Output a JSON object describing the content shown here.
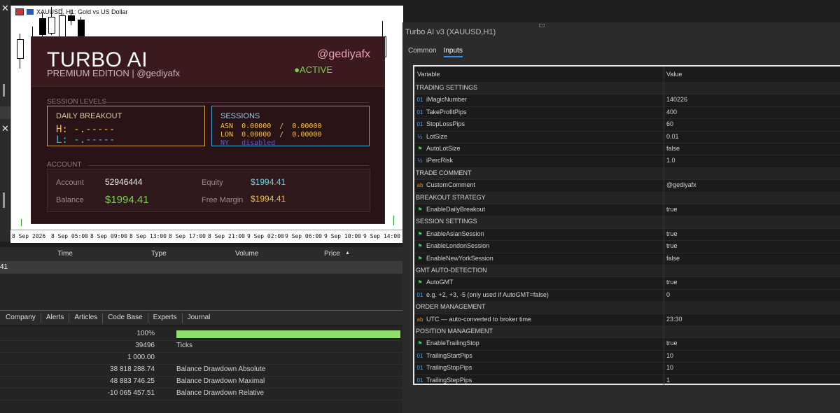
{
  "chart": {
    "symbol_title": "XAUUSD, H1:  Gold vs US Dollar",
    "time_labels": [
      "8 Sep 2026",
      "8 Sep 05:00",
      "8 Sep 09:00",
      "8 Sep 13:00",
      "8 Sep 17:00",
      "8 Sep 21:00",
      "9 Sep 02:00",
      "9 Sep 06:00",
      "9 Sep 10:00",
      "9 Sep 14:00"
    ]
  },
  "turbo_panel": {
    "title": "TURBO AI",
    "subtitle": "PREMIUM EDITION  |  @gediyafx",
    "handle": "@gediyafx",
    "status": "●ACTIVE",
    "session_levels_label": "SESSION LEVELS",
    "daily_breakout": {
      "label": "DAILY BREAKOUT",
      "high": "H: -.-----",
      "low": "L: -.-----"
    },
    "sessions": {
      "label": "SESSIONS",
      "asn": "ASN  0.00000  /  0.00000",
      "lon": "LON  0.00000  /  0.00000",
      "ny": "NY   disabled"
    },
    "account_label": "ACCOUNT",
    "account": {
      "account_label": "Account",
      "account_value": "52946444",
      "equity_label": "Equity",
      "equity_value": "$1994.41",
      "balance_label": "Balance",
      "balance_value": "$1994.41",
      "free_margin_label": "Free Margin",
      "free_margin_value": "$1994.41"
    }
  },
  "dialog": {
    "title": "Turbo AI v3 (XAUUSD,H1)",
    "tabs": [
      "Common",
      "Inputs"
    ],
    "active_tab": "Inputs",
    "columns": [
      "Variable",
      "Value"
    ],
    "rows": [
      {
        "section": true,
        "name": "TRADING SETTINGS",
        "value": ""
      },
      {
        "icon": "01",
        "name": "iMagicNumber",
        "value": "140226"
      },
      {
        "icon": "01",
        "name": "TakeProfitPips",
        "value": "400"
      },
      {
        "icon": "01",
        "name": "StopLossPips",
        "value": "60"
      },
      {
        "icon": "½",
        "name": "LotSize",
        "value": "0.01"
      },
      {
        "icon": "flag",
        "name": "AutoLotSize",
        "value": "false"
      },
      {
        "icon": "½",
        "name": "iPercRisk",
        "value": "1.0"
      },
      {
        "section": true,
        "name": "TRADE COMMENT",
        "value": ""
      },
      {
        "icon": "ab",
        "name": "CustomComment",
        "value": "@gediyafx"
      },
      {
        "section": true,
        "name": "BREAKOUT STRATEGY",
        "value": ""
      },
      {
        "icon": "flag",
        "name": "EnableDailyBreakout",
        "value": "true"
      },
      {
        "section": true,
        "name": "SESSION SETTINGS",
        "value": ""
      },
      {
        "icon": "flag",
        "name": "EnableAsianSession",
        "value": "true"
      },
      {
        "icon": "flag",
        "name": "EnableLondonSession",
        "value": "true"
      },
      {
        "icon": "flag",
        "name": "EnableNewYorkSession",
        "value": "false"
      },
      {
        "section": true,
        "name": "GMT AUTO-DETECTION",
        "value": ""
      },
      {
        "icon": "flag",
        "name": "AutoGMT",
        "value": "true"
      },
      {
        "icon": "01",
        "name": "e.g. +2, +3, -5 (only used if AutoGMT=false)",
        "value": "0"
      },
      {
        "section": true,
        "name": "ORDER MANAGEMENT",
        "value": ""
      },
      {
        "icon": "ab",
        "name": "UTC — auto-converted to broker time",
        "value": "23:30"
      },
      {
        "section": true,
        "name": "POSITION MANAGEMENT",
        "value": ""
      },
      {
        "icon": "flag",
        "name": "EnableTrailingStop",
        "value": "true"
      },
      {
        "icon": "01",
        "name": "TrailingStartPips",
        "value": "10"
      },
      {
        "icon": "01",
        "name": "TrailingStopPips",
        "value": "10"
      },
      {
        "icon": "01",
        "name": "TrailingStepPips",
        "value": "1"
      }
    ]
  },
  "trade_table": {
    "columns": [
      "Time",
      "Type",
      "Volume",
      "Price"
    ],
    "row_value": "41"
  },
  "bottom_tabs": [
    "Company",
    "Alerts",
    "Articles",
    "Code Base",
    "Experts",
    "Journal"
  ],
  "stats": [
    {
      "value": "100%",
      "label": "",
      "progress": 1.0
    },
    {
      "value": "39496",
      "label": "Ticks"
    },
    {
      "value": "1 000.00",
      "label": ""
    },
    {
      "value": "38 818 288.74",
      "label": "Balance Drawdown Absolute"
    },
    {
      "value": "48 883 746.25",
      "label": "Balance Drawdown Maximal"
    },
    {
      "value": "-10 065 457.51",
      "label": "Balance Drawdown Relative"
    }
  ],
  "colors": {
    "panel_bg": "#2a1317",
    "accent_pink": "#e9a1b5",
    "active_green": "#7ad04a",
    "breakout_border": "#d6a04a",
    "sessions_border": "#48a6d9",
    "progress_green": "#8ee06a"
  }
}
